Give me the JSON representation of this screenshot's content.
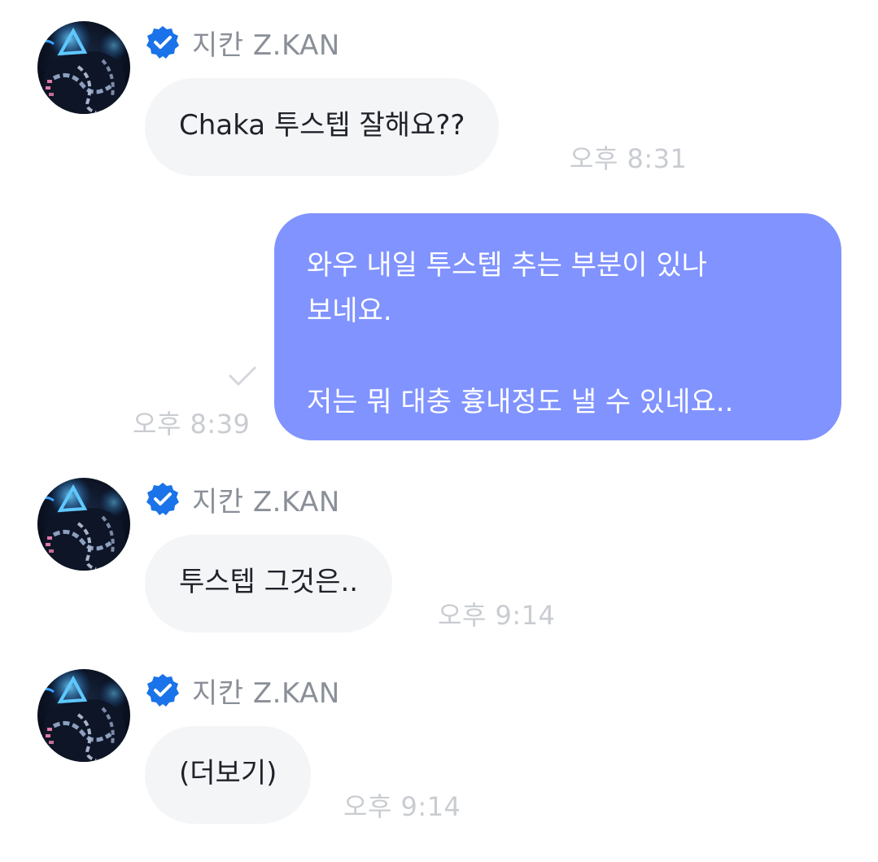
{
  "colors": {
    "incoming_bubble": "#f4f5f7",
    "outgoing_bubble": "#8093ff",
    "verified_badge": "#1a73e8",
    "timestamp": "#c9ccd1",
    "sender_name": "#8a8f98"
  },
  "icons": {
    "avatar": "dark-character-avatar",
    "badge": "verified-badge-icon",
    "read_receipt": "checkmark-icon"
  },
  "messages": [
    {
      "direction": "incoming",
      "sender": "지칸 Z.KAN",
      "verified": true,
      "text": "Chaka 투스텝 잘해요??",
      "time": "오후 8:31"
    },
    {
      "direction": "outgoing",
      "text": "와우 내일 투스텝 추는 부분이 있나\n보네요.\n\n저는 뭐 대충 흉내정도 낼 수 있네요..",
      "time": "오후 8:39",
      "read": true
    },
    {
      "direction": "incoming",
      "sender": "지칸 Z.KAN",
      "verified": true,
      "text": "투스텝 그것은..",
      "time": "오후 9:14"
    },
    {
      "direction": "incoming",
      "sender": "지칸 Z.KAN",
      "verified": true,
      "text": "(더보기)",
      "time": "오후 9:14"
    }
  ]
}
